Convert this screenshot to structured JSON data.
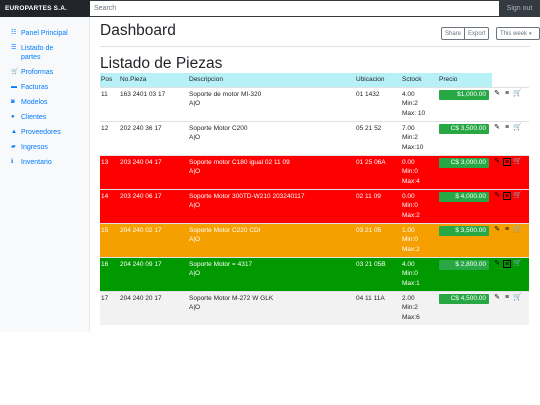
{
  "topbar": {
    "brand": "EUROPARTES S.A.",
    "search_placeholder": "Search",
    "signout": "Sign out"
  },
  "sidebar": {
    "items": [
      {
        "label": "Panel Principal",
        "icon": "dashboard-icon"
      },
      {
        "label": "Listado de partes",
        "icon": "list-icon"
      },
      {
        "label": "Proformas",
        "icon": "cart-icon"
      },
      {
        "label": "Facturas",
        "icon": "folder-icon"
      },
      {
        "label": "Modelos",
        "icon": "car-icon"
      },
      {
        "label": "Clientes",
        "icon": "user-icon"
      },
      {
        "label": "Proveedores",
        "icon": "bell-icon"
      },
      {
        "label": "Ingresos",
        "icon": "ticket-icon"
      },
      {
        "label": "Inventario",
        "icon": "info-icon"
      }
    ]
  },
  "header": {
    "title": "Dashboard",
    "share": "Share",
    "export": "Export",
    "period": "This week"
  },
  "section_title": "Listado de Piezas",
  "table": {
    "columns": [
      "Pos",
      "No.Pieza",
      "Descripcion",
      "Ubicacion",
      "Sctock",
      "Precio"
    ],
    "rows": [
      {
        "pos": "11",
        "pieza": "163 2401 03 17",
        "desc": "Soporte de motor MI-320",
        "desc2": "A|O",
        "ubic": "01 1432",
        "stock": "4.00",
        "min": "Min:2",
        "max": "Max: 10",
        "price": "$1,000.00",
        "color": "white"
      },
      {
        "pos": "12",
        "pieza": "202 240 36 17",
        "desc": "Soporte Motor C200",
        "desc2": "A|O",
        "ubic": "05 21 52",
        "stock": "7.00",
        "min": "Min:2",
        "max": "Max:10",
        "price": "C$ 3,500.00",
        "color": "white"
      },
      {
        "pos": "13",
        "pieza": "203 240 04 17",
        "desc": "Soporte motor C180 igual 02 11 09",
        "desc2": "A|O",
        "ubic": "01 25 06A",
        "stock": "0.00",
        "min": "Min:0",
        "max": "Max:4",
        "price": "C$ 3,000.00",
        "color": "red"
      },
      {
        "pos": "14",
        "pieza": "203 240 06 17",
        "desc": "Soporte Motor 300TD-W210 203240117",
        "desc2": "A|O",
        "ubic": "02 11 09",
        "stock": "0.00",
        "min": "Min:0",
        "max": "Max:2",
        "price": "$ 4,000.00",
        "color": "red"
      },
      {
        "pos": "15",
        "pieza": "204 240 02 17",
        "desc": "Soporte Motor C220 CDI",
        "desc2": "A|O",
        "ubic": "03 21 05",
        "stock": "1.00",
        "min": "Min:0",
        "max": "Max:2",
        "price": "$ 3,500.00",
        "color": "orange"
      },
      {
        "pos": "16",
        "pieza": "204 240 09 17",
        "desc": "Soporte Motor = 4317",
        "desc2": "A|O",
        "ubic": "03 21 05B",
        "stock": "4.00",
        "min": "Min:0",
        "max": "Max:1",
        "price": "$ 2,800.00",
        "color": "green"
      },
      {
        "pos": "17",
        "pieza": "204 240 20 17",
        "desc": "Soporte Motor M-272 W GLK",
        "desc2": "A|O",
        "ubic": "04 11 11A",
        "stock": "2.00",
        "min": "Min:2",
        "max": "Max:6",
        "price": "C$ 4,500.00",
        "color": "grey"
      }
    ]
  },
  "colors": {
    "header_bg": "#b8f0f8",
    "red": "#ff0000",
    "orange": "#f5a000",
    "green": "#009a00",
    "price_badge": "#28a745",
    "link": "#007bff"
  }
}
